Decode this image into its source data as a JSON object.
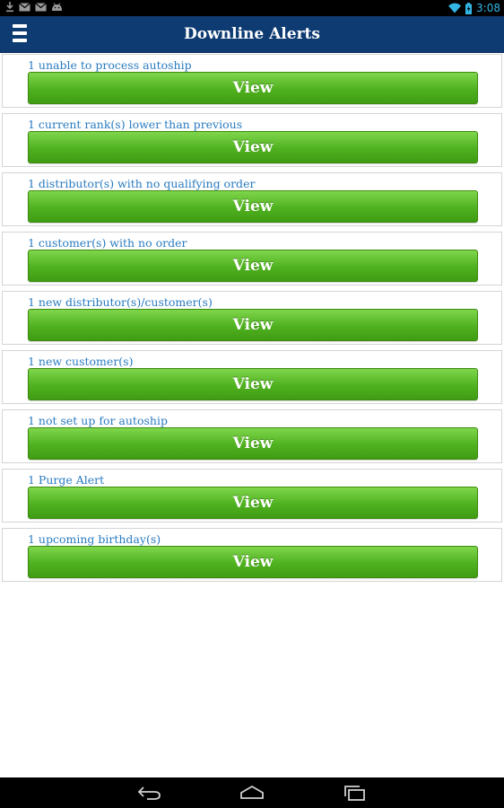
{
  "status_bar": {
    "time": "3:08",
    "icons": [
      "download-icon",
      "gmail-icon",
      "gmail-icon",
      "android-icon",
      "wifi-icon",
      "battery-charging-icon"
    ],
    "accent_color": "#33b5e5"
  },
  "action_bar": {
    "title": "Downline Alerts",
    "menu_icon": "hamburger-menu-icon",
    "background_color": "#0e3b72"
  },
  "alerts": [
    {
      "label": "1 unable to process autoship",
      "button_label": "View"
    },
    {
      "label": "1 current rank(s) lower than previous",
      "button_label": "View"
    },
    {
      "label": "1 distributor(s) with no qualifying order",
      "button_label": "View"
    },
    {
      "label": "1 customer(s) with no order",
      "button_label": "View"
    },
    {
      "label": "1 new distributor(s)/customer(s)",
      "button_label": "View"
    },
    {
      "label": "1 new customer(s)",
      "button_label": "View"
    },
    {
      "label": "1 not set up for autoship",
      "button_label": "View"
    },
    {
      "label": "1 Purge Alert",
      "button_label": "View"
    },
    {
      "label": "1 upcoming birthday(s)",
      "button_label": "View"
    }
  ],
  "colors": {
    "label_text": "#2a7bc0",
    "button_green": "#4fb11f"
  },
  "nav_bar": {
    "icons": [
      "back-icon",
      "home-icon",
      "recent-apps-icon"
    ]
  }
}
